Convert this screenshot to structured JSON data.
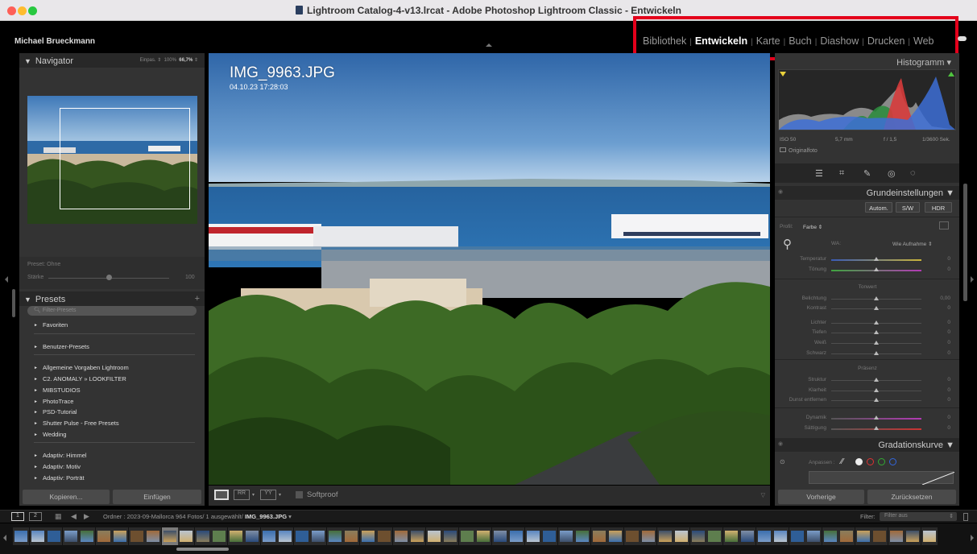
{
  "window": {
    "title": "Lightroom Catalog-4-v13.lrcat - Adobe Photoshop Lightroom Classic - Entwickeln"
  },
  "header": {
    "user": "Michael Brueckmann",
    "modules": [
      {
        "label": "Bibliothek",
        "active": false
      },
      {
        "label": "Entwickeln",
        "active": true
      },
      {
        "label": "Karte",
        "active": false
      },
      {
        "label": "Buch",
        "active": false
      },
      {
        "label": "Diashow",
        "active": false
      },
      {
        "label": "Drucken",
        "active": false
      },
      {
        "label": "Web",
        "active": false
      }
    ],
    "separator": "|"
  },
  "navigator": {
    "title": "Navigator",
    "zoom_fit": "Einpas.",
    "zoom_100": "100%",
    "zoom_current": "66,7%"
  },
  "preset_amount": {
    "preset_label": "Preset: Ohne",
    "amount_label": "Stärke",
    "amount_value": "100",
    "amount_level": 0.5
  },
  "presets": {
    "title": "Presets",
    "add_symbol": "+",
    "search_placeholder": "Filter-Presets",
    "groups": [
      [
        "Favoriten"
      ],
      [
        "Benutzer-Presets"
      ],
      [
        "Allgemeine Vorgaben Lightroom",
        "C2. ANOMALY » LOOKFILTER",
        "MIBSTUDIOS",
        "PhotoTrace",
        "PSD-Tutorial",
        "Shutter Pulse - Free Presets",
        "Wedding"
      ],
      [
        "Adaptiv: Himmel",
        "Adaptiv: Motiv",
        "Adaptiv: Porträt"
      ]
    ]
  },
  "left_buttons": {
    "copy": "Kopieren...",
    "paste": "Einfügen"
  },
  "image": {
    "filename": "IMG_9963.JPG",
    "datetime": "04.10.23 17:28:03"
  },
  "toolbar": {
    "softproof": "Softproof"
  },
  "histogram": {
    "title": "Histogramm",
    "iso": "ISO 50",
    "focal": "5,7 mm",
    "aperture": "f / 1,5",
    "shutter": "1/3600 Sek.",
    "original": "Originalfoto"
  },
  "basic": {
    "title": "Grundeinstellungen",
    "auto": "Autom.",
    "bw": "S/W",
    "hdr": "HDR",
    "profile_label": "Profil:",
    "profile_value": "Farbe",
    "wb_label": "WA:",
    "wb_value": "Wie Aufnahme",
    "tone_header": "Tonwert",
    "presence_header": "Präsenz",
    "sliders": [
      {
        "label": "Temperatur",
        "value": "0",
        "pos": 0.5
      },
      {
        "label": "Tönung",
        "value": "0",
        "pos": 0.5
      },
      {
        "label": "Belichtung",
        "value": "0,00",
        "pos": 0.5
      },
      {
        "label": "Kontrast",
        "value": "0",
        "pos": 0.5
      },
      {
        "label": "Lichter",
        "value": "0",
        "pos": 0.5
      },
      {
        "label": "Tiefen",
        "value": "0",
        "pos": 0.5
      },
      {
        "label": "Weiß",
        "value": "0",
        "pos": 0.5
      },
      {
        "label": "Schwarz",
        "value": "0",
        "pos": 0.5
      },
      {
        "label": "Struktur",
        "value": "0",
        "pos": 0.5
      },
      {
        "label": "Klarheit",
        "value": "0",
        "pos": 0.5
      },
      {
        "label": "Dunst entfernen",
        "value": "0",
        "pos": 0.5
      },
      {
        "label": "Dynamik",
        "value": "0",
        "pos": 0.5
      },
      {
        "label": "Sättigung",
        "value": "0",
        "pos": 0.5
      }
    ]
  },
  "tone_curve": {
    "title": "Gradationskurve",
    "adjust_label": "Anpassen :"
  },
  "right_buttons": {
    "previous": "Vorherige",
    "reset": "Zurücksetzen"
  },
  "filmstrip_bar": {
    "view1": "1",
    "view2": "2",
    "folder_text": "Ordner : 2023-09-Mallorca   964 Fotos/ 1 ausgewählt/",
    "current_file": "IMG_9963.JPG",
    "filter_label": "Filter:",
    "filter_value": "Filter aus"
  },
  "colors": {
    "highlight_box": "#e4001b",
    "panel_bg": "#333333",
    "panel_header": "#282828"
  }
}
